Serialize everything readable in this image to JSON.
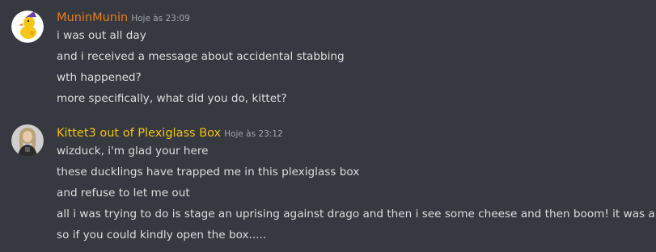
{
  "messages": [
    {
      "author": "MuninMunin",
      "author_color": "#e67e22",
      "timestamp": "Hoje às 23:09",
      "avatar_icon": "yellow-duck-avatar-icon",
      "lines": [
        "i was out all day",
        "and i received a message about accidental stabbing",
        "wth happened?",
        "more specifically, what did you do, kittet?"
      ]
    },
    {
      "author": "Kittet3 out of Plexiglass Box",
      "author_color": "#f1c40f",
      "timestamp": "Hoje às 23:12",
      "avatar_icon": "user-photo-avatar-icon",
      "lines": [
        "wizduck, i'm glad your here",
        "these ducklings have trapped me in this plexiglass box",
        "and refuse to let me out",
        "all i was trying to do is stage an uprising against drago and then i see some cheese and then boom! it was a trap",
        "so if you could kindly open the box....."
      ]
    }
  ]
}
